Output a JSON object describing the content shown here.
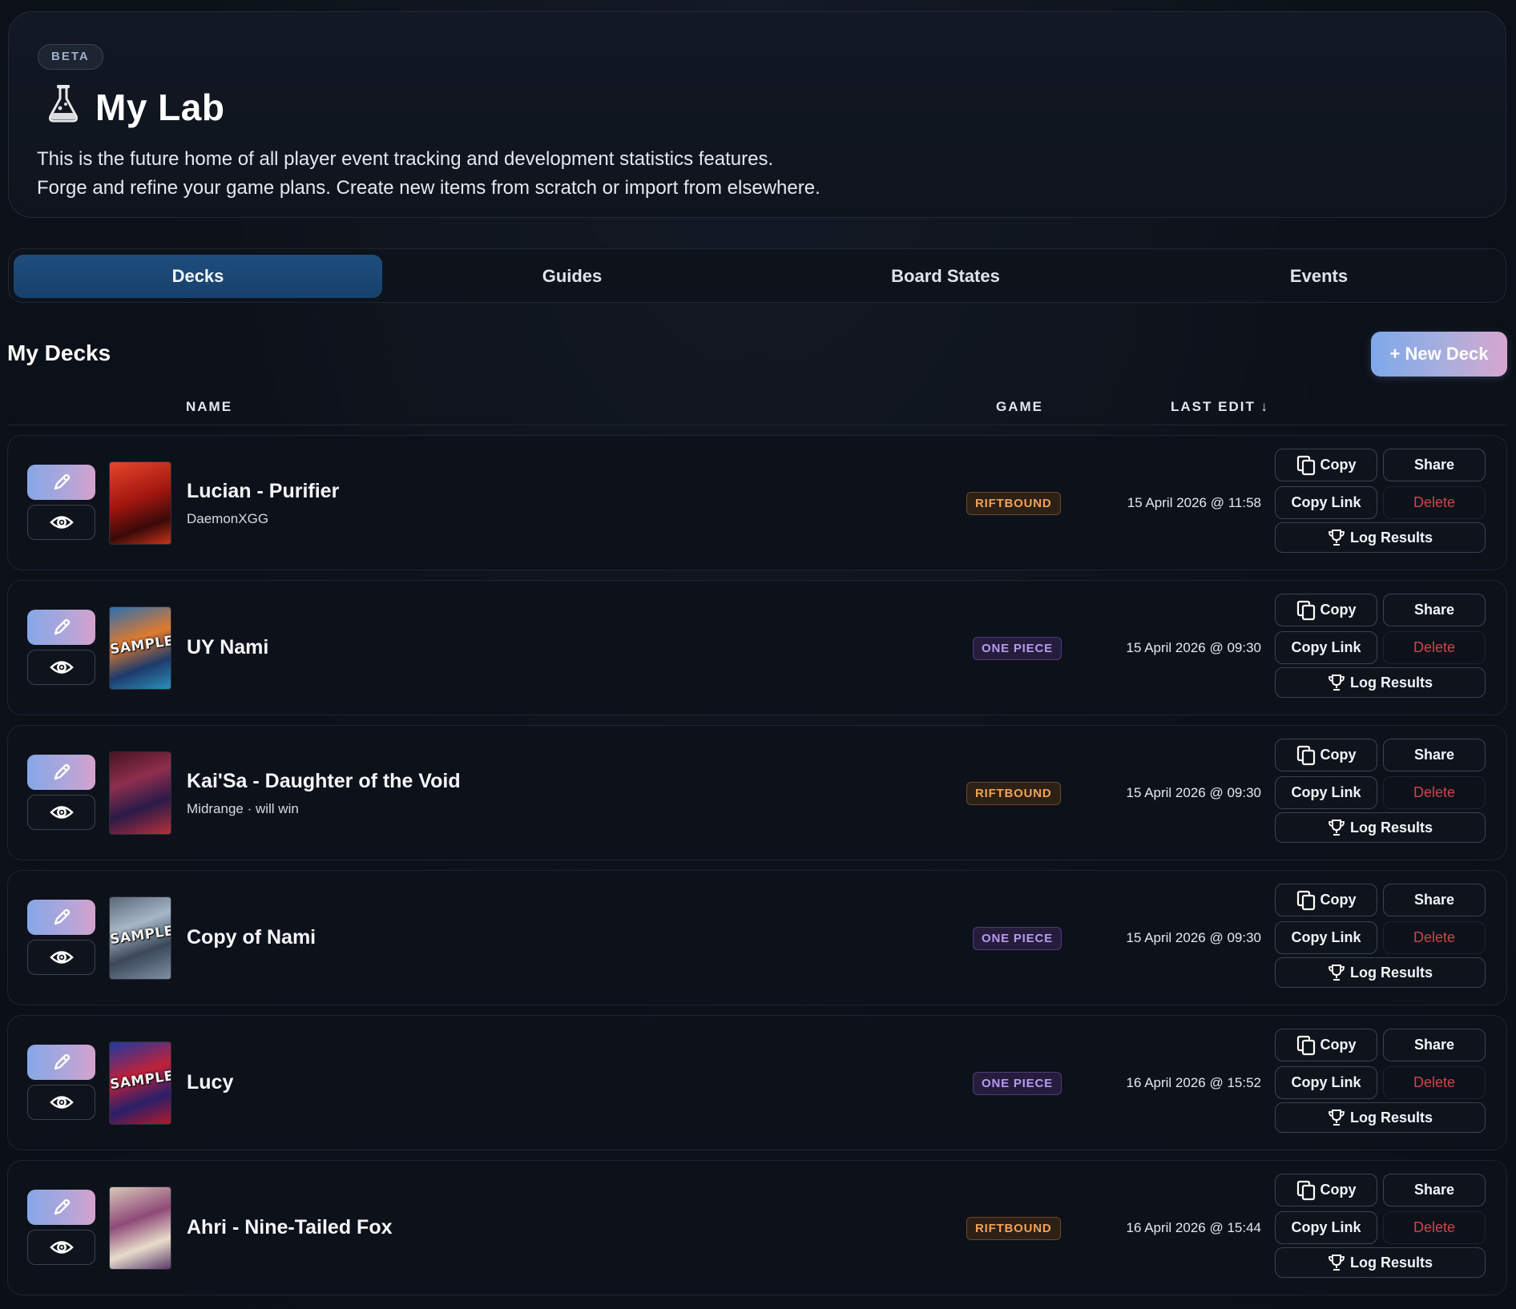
{
  "header": {
    "badge": "BETA",
    "title": "My Lab",
    "icon": "flask-icon",
    "description_line1": "This is the future home of all player event tracking and development statistics features.",
    "description_line2": "Forge and refine your game plans. Create new items from scratch or import from elsewhere."
  },
  "tabs": [
    {
      "label": "Decks",
      "active": true
    },
    {
      "label": "Guides",
      "active": false
    },
    {
      "label": "Board States",
      "active": false
    },
    {
      "label": "Events",
      "active": false
    }
  ],
  "section": {
    "title": "My Decks",
    "new_button": "+ New Deck"
  },
  "columns": {
    "name": "NAME",
    "game": "GAME",
    "last_edit": "LAST EDIT ↓"
  },
  "actions": {
    "copy": "Copy",
    "share": "Share",
    "copy_link": "Copy Link",
    "delete": "Delete",
    "log_results": "Log Results"
  },
  "decks": [
    {
      "name": "Lucian - Purifier",
      "subtitle": "DaemonXGG",
      "game": "RIFTBOUND",
      "last_edit": "15 April 2026 @ 11:58",
      "thumb_watermark": ""
    },
    {
      "name": "UY Nami",
      "subtitle": "",
      "game": "ONE PIECE",
      "last_edit": "15 April 2026 @ 09:30",
      "thumb_watermark": "SAMPLE"
    },
    {
      "name": "Kai'Sa - Daughter of the Void",
      "subtitle": "Midrange · will win",
      "game": "RIFTBOUND",
      "last_edit": "15 April 2026 @ 09:30",
      "thumb_watermark": ""
    },
    {
      "name": "Copy of Nami",
      "subtitle": "",
      "game": "ONE PIECE",
      "last_edit": "15 April 2026 @ 09:30",
      "thumb_watermark": "SAMPLE"
    },
    {
      "name": "Lucy",
      "subtitle": "",
      "game": "ONE PIECE",
      "last_edit": "16 April 2026 @ 15:52",
      "thumb_watermark": "SAMPLE"
    },
    {
      "name": "Ahri - Nine-Tailed Fox",
      "subtitle": "",
      "game": "RIFTBOUND",
      "last_edit": "16 April 2026 @ 15:44",
      "thumb_watermark": ""
    }
  ],
  "colors": {
    "accent_tab": "#1e4d7d",
    "riftbound_badge": "#f1a257",
    "one_piece_badge": "#b69af1",
    "delete": "#c8474e"
  }
}
